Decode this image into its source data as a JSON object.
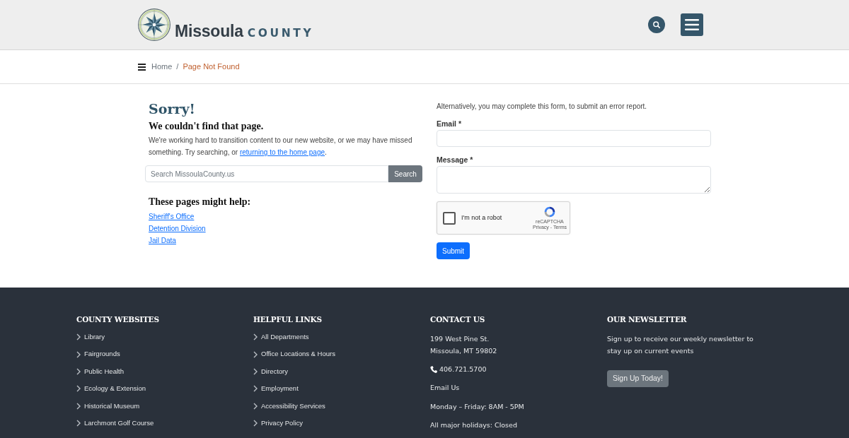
{
  "header": {
    "logo": {
      "name": "Missoula",
      "suffix": "COUNTY"
    }
  },
  "breadcrumb": {
    "separator": "/",
    "items": [
      {
        "label": "Home",
        "current": false
      },
      {
        "label": "Page Not Found",
        "current": true
      }
    ]
  },
  "error": {
    "title": "Sorry!",
    "subtitle": "We couldn't find that page.",
    "message": {
      "text": "We're working hard to transition content to our new website, or we may have missed something. Try searching, or ",
      "link": "returning to the home page",
      "end": "."
    },
    "search": {
      "placeholder": "Search MissoulaCounty.us",
      "button": "Search"
    },
    "help": {
      "heading": "These pages might help:",
      "links": [
        "Sheriff's Office",
        "Detention Division",
        "Jail Data"
      ]
    }
  },
  "form": {
    "intro": "Alternatively, you may complete this form, to submit an error report.",
    "fields": [
      {
        "kind": "input",
        "label": "Email *"
      },
      {
        "kind": "textarea",
        "label": "Message *"
      }
    ],
    "captcha": {
      "label": "I'm not a robot",
      "checked": false,
      "brand": "reCAPTCHA",
      "terms": "Privacy - Terms"
    },
    "submit": "Submit"
  },
  "footer": {
    "columns": [
      {
        "kind": "links",
        "heading": "COUNTY WEBSITES",
        "items": [
          "Library",
          "Fairgrounds",
          "Public Health",
          "Ecology & Extension",
          "Historical Museum",
          "Larchmont Golf Course"
        ]
      },
      {
        "kind": "links",
        "heading": "HELPFUL LINKS",
        "items": [
          "All Departments",
          "Office Locations & Hours",
          "Directory",
          "Employment",
          "Accessibility Services",
          "Privacy Policy"
        ]
      },
      {
        "kind": "contact",
        "heading": "CONTACT US",
        "address": [
          "199 West Pine St.",
          "Missoula, MT 59802"
        ],
        "phone": "406.721.5700",
        "lines": [
          {
            "kind": "link",
            "text": "Email Us"
          },
          {
            "kind": "text",
            "text": "Monday – Friday: 8AM - 5PM"
          },
          {
            "kind": "text",
            "text": "All major holidays: Closed"
          }
        ]
      },
      {
        "kind": "newsletter",
        "heading": "OUR NEWSLETTER",
        "text": "Sign up to receive our weekly newsletter to stay up on current events",
        "button": "Sign Up Today!"
      }
    ]
  }
}
